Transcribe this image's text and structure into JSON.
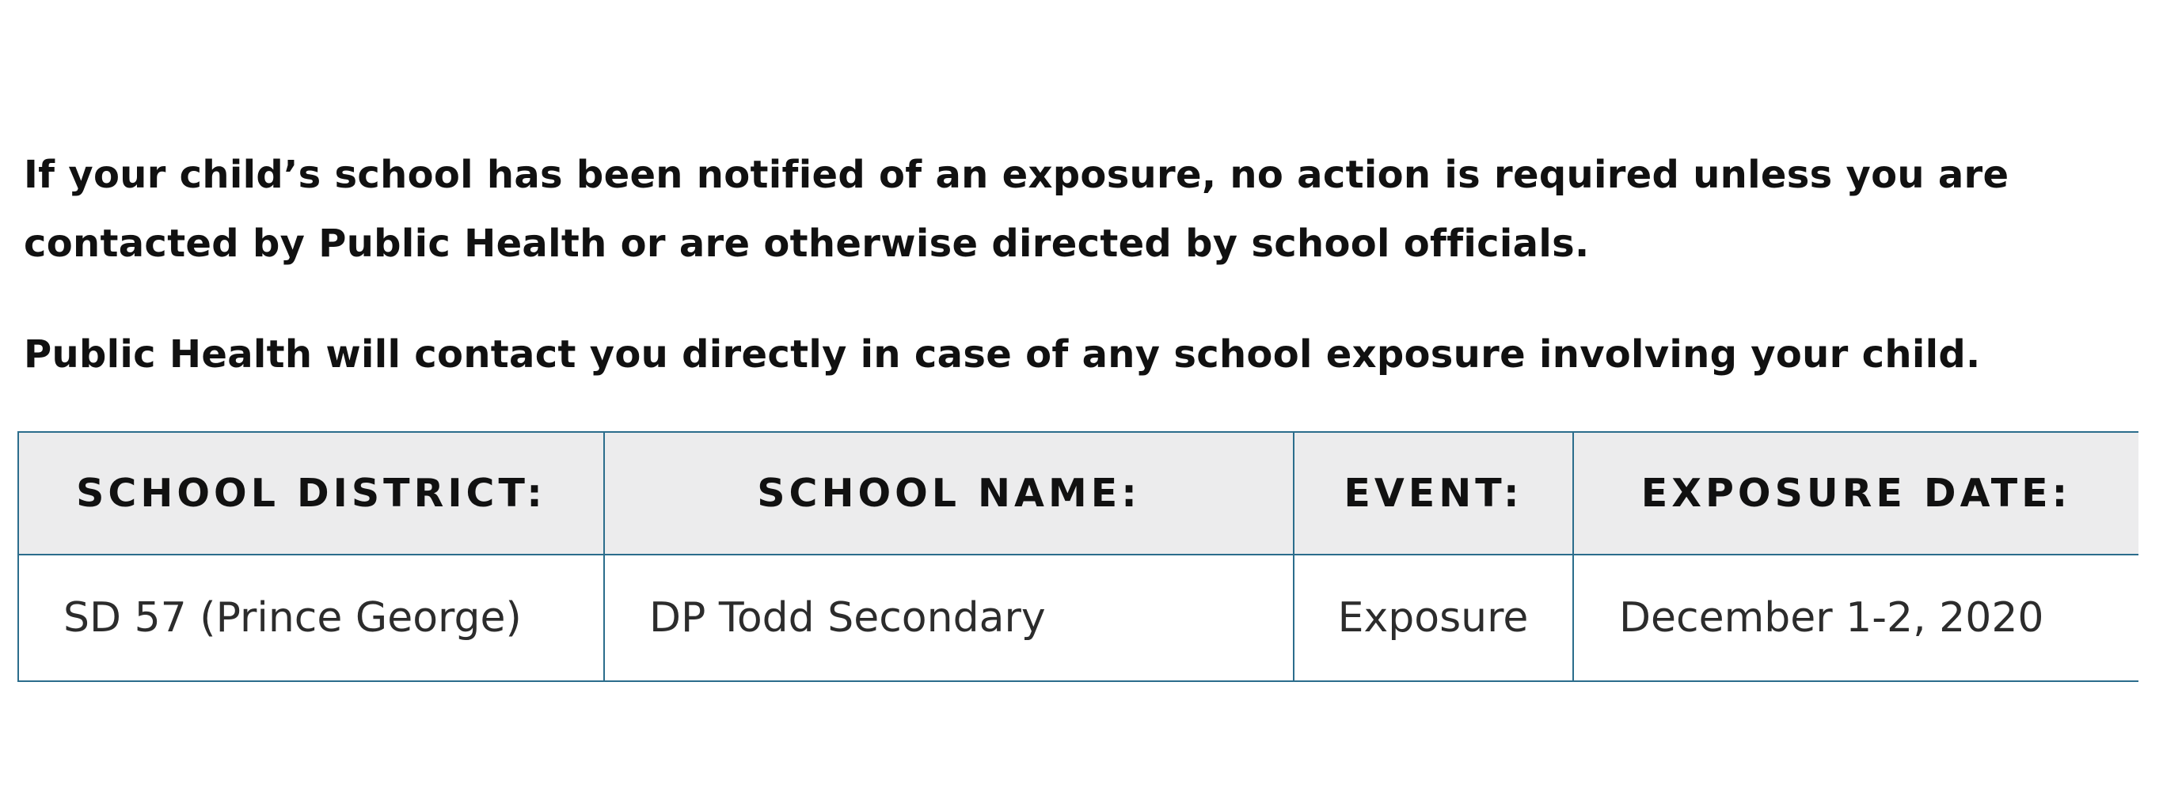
{
  "notice": {
    "paragraph_1": "If your child’s school has been notified of an exposure, no action is required unless you are contacted by Public Health or are otherwise directed by school officials.",
    "paragraph_2": "Public Health will contact you directly in case of any school exposure involving your child."
  },
  "table": {
    "headers": {
      "school_district": "SCHOOL DISTRICT:",
      "school_name": "SCHOOL NAME:",
      "event": "EVENT:",
      "exposure_date": "EXPOSURE DATE:"
    },
    "rows": [
      {
        "school_district": "SD 57 (Prince George)",
        "school_name": "DP Todd Secondary",
        "event": "Exposure",
        "exposure_date": "December 1-2, 2020"
      }
    ]
  },
  "colors": {
    "border": "#2b6d8c",
    "header_background": "#ececed",
    "text": "#111111"
  }
}
